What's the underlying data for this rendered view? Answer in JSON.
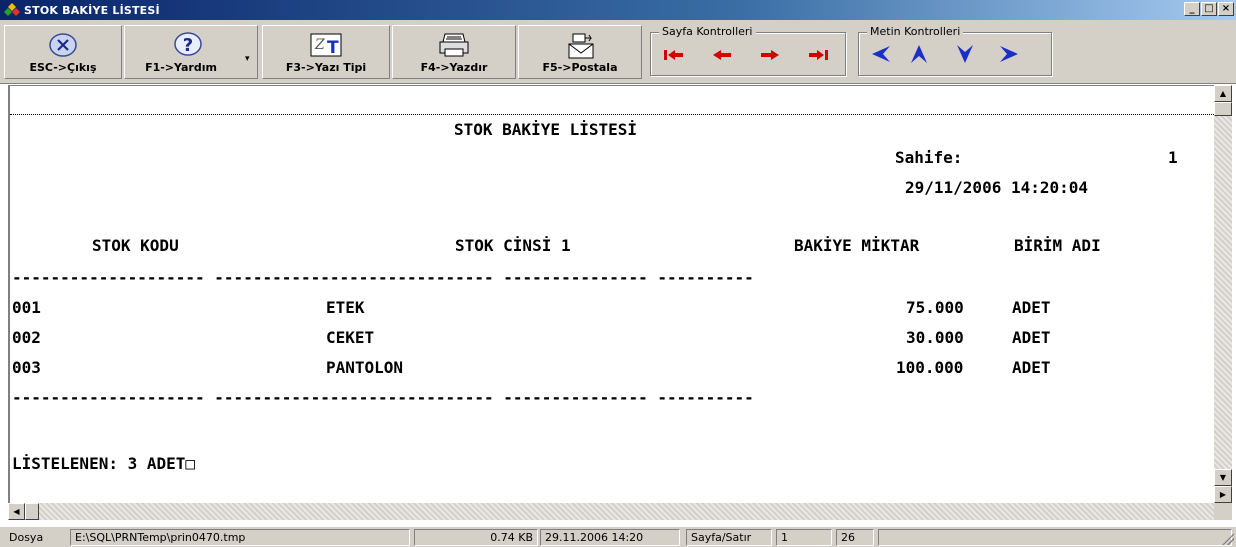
{
  "window": {
    "title": "STOK BAKİYE LİSTESİ",
    "buttons": {
      "minimize": "_",
      "maximize": "□",
      "close": "×"
    }
  },
  "toolbar": {
    "exit_label": "ESC->Çıkış",
    "help_label": "F1->Yardım",
    "font_label": "F3->Yazı Tipi",
    "print_label": "F4->Yazdır",
    "mail_label": "F5->Postala",
    "page_controls_title": "Sayfa Kontrolleri",
    "text_controls_title": "Metin Kontrolleri",
    "icons": {
      "exit": "close-circle-icon",
      "help": "help-question-icon",
      "font": "font-icon",
      "print": "printer-icon",
      "mail": "envelope-icon",
      "page": [
        "first-page-icon",
        "prev-page-icon",
        "next-page-icon",
        "last-page-icon"
      ],
      "text": [
        "scroll-left-icon",
        "scroll-up-icon",
        "scroll-down-icon",
        "scroll-right-icon"
      ]
    }
  },
  "report": {
    "title": "STOK BAKİYE LİSTESİ",
    "page_label": "Sahife:",
    "page_number": "1",
    "datetime": "29/11/2006 14:20:04",
    "columns": [
      "STOK KODU",
      "STOK CİNSİ 1",
      "BAKİYE MİKTAR",
      "BİRİM ADI"
    ],
    "separator_line": "-------------------- ----------------------------- --------------- ----------",
    "rows": [
      {
        "code": "001",
        "name": "ETEK",
        "qty": "75.000",
        "unit": "ADET"
      },
      {
        "code": "002",
        "name": "CEKET",
        "qty": "30.000",
        "unit": "ADET"
      },
      {
        "code": "003",
        "name": "PANTOLON",
        "qty": "100.000",
        "unit": "ADET"
      }
    ],
    "footer": "LİSTELENEN: 3 ADET□"
  },
  "statusbar": {
    "label": "Dosya",
    "path": "E:\\SQL\\PRNTemp\\prin0470.tmp",
    "size": "0.74 KB",
    "file_datetime": "29.11.2006 14:20",
    "page_row_label": "Sayfa/Satır",
    "page": "1",
    "row": "26"
  },
  "colors": {
    "titlebar_start": "#0a246a",
    "titlebar_end": "#a6caf0",
    "face": "#d4d0c8",
    "arrow_red": "#d40000",
    "arrow_blue": "#1a2fc8"
  }
}
